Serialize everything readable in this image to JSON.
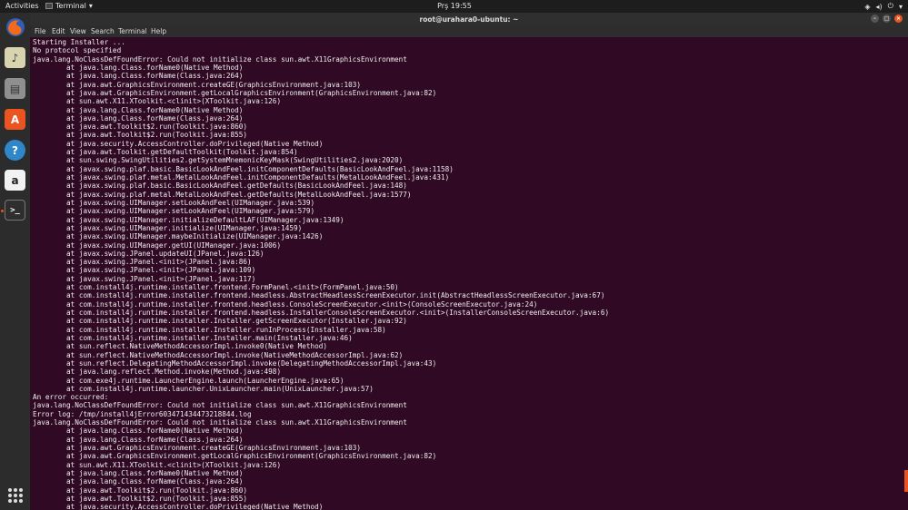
{
  "topbar": {
    "activities": "Activities",
    "app_name": "Terminal",
    "app_arrow": "▾",
    "clock": "Prş 19:55",
    "tray_icons": [
      "wifi-icon",
      "volume-icon",
      "power-icon"
    ],
    "tray_glyphs": [
      "◈",
      "◂)",
      "⏻"
    ],
    "tray_arrow": "▾"
  },
  "dock": {
    "items": [
      {
        "name": "firefox-icon",
        "glyph": "",
        "color": "#e66000"
      },
      {
        "name": "rhythmbox-icon",
        "glyph": "♪",
        "color": "#c9c06a"
      },
      {
        "name": "files-icon",
        "glyph": "▤",
        "color": "#9b9b9b"
      },
      {
        "name": "software-center-icon",
        "glyph": "A",
        "color": "#e95420"
      },
      {
        "name": "help-icon",
        "glyph": "?",
        "color": "#2f86c8"
      },
      {
        "name": "amazon-icon",
        "glyph": "a",
        "color": "#f2f2f2"
      },
      {
        "name": "terminal-icon",
        "glyph": ">_",
        "color": "#2e2e2e"
      }
    ],
    "accent": "#e95420"
  },
  "window": {
    "title": "root@urahara0-ubuntu: ~",
    "menu": [
      "File",
      "Edit",
      "View",
      "Search",
      "Terminal",
      "Help"
    ]
  },
  "terminal": {
    "lines": [
      "Starting Installer ...",
      "No protocol specified",
      "java.lang.NoClassDefFoundError: Could not initialize class sun.awt.X11GraphicsEnvironment",
      "        at java.lang.Class.forName0(Native Method)",
      "        at java.lang.Class.forName(Class.java:264)",
      "        at java.awt.GraphicsEnvironment.createGE(GraphicsEnvironment.java:103)",
      "        at java.awt.GraphicsEnvironment.getLocalGraphicsEnvironment(GraphicsEnvironment.java:82)",
      "        at sun.awt.X11.XToolkit.<clinit>(XToolkit.java:126)",
      "        at java.lang.Class.forName0(Native Method)",
      "        at java.lang.Class.forName(Class.java:264)",
      "        at java.awt.Toolkit$2.run(Toolkit.java:860)",
      "        at java.awt.Toolkit$2.run(Toolkit.java:855)",
      "        at java.security.AccessController.doPrivileged(Native Method)",
      "        at java.awt.Toolkit.getDefaultToolkit(Toolkit.java:854)",
      "        at sun.swing.SwingUtilities2.getSystemMnemonicKeyMask(SwingUtilities2.java:2020)",
      "        at javax.swing.plaf.basic.BasicLookAndFeel.initComponentDefaults(BasicLookAndFeel.java:1158)",
      "        at javax.swing.plaf.metal.MetalLookAndFeel.initComponentDefaults(MetalLookAndFeel.java:431)",
      "        at javax.swing.plaf.basic.BasicLookAndFeel.getDefaults(BasicLookAndFeel.java:148)",
      "        at javax.swing.plaf.metal.MetalLookAndFeel.getDefaults(MetalLookAndFeel.java:1577)",
      "        at javax.swing.UIManager.setLookAndFeel(UIManager.java:539)",
      "        at javax.swing.UIManager.setLookAndFeel(UIManager.java:579)",
      "        at javax.swing.UIManager.initializeDefaultLAF(UIManager.java:1349)",
      "        at javax.swing.UIManager.initialize(UIManager.java:1459)",
      "        at javax.swing.UIManager.maybeInitialize(UIManager.java:1426)",
      "        at javax.swing.UIManager.getUI(UIManager.java:1006)",
      "        at javax.swing.JPanel.updateUI(JPanel.java:126)",
      "        at javax.swing.JPanel.<init>(JPanel.java:86)",
      "        at javax.swing.JPanel.<init>(JPanel.java:109)",
      "        at javax.swing.JPanel.<init>(JPanel.java:117)",
      "        at com.install4j.runtime.installer.frontend.FormPanel.<init>(FormPanel.java:50)",
      "        at com.install4j.runtime.installer.frontend.headless.AbstractHeadlessScreenExecutor.init(AbstractHeadlessScreenExecutor.java:67)",
      "        at com.install4j.runtime.installer.frontend.headless.ConsoleScreenExecutor.<init>(ConsoleScreenExecutor.java:24)",
      "        at com.install4j.runtime.installer.frontend.headless.InstallerConsoleScreenExecutor.<init>(InstallerConsoleScreenExecutor.java:6)",
      "        at com.install4j.runtime.installer.Installer.getScreenExecutor(Installer.java:92)",
      "        at com.install4j.runtime.installer.Installer.runInProcess(Installer.java:58)",
      "        at com.install4j.runtime.installer.Installer.main(Installer.java:46)",
      "        at sun.reflect.NativeMethodAccessorImpl.invoke0(Native Method)",
      "        at sun.reflect.NativeMethodAccessorImpl.invoke(NativeMethodAccessorImpl.java:62)",
      "        at sun.reflect.DelegatingMethodAccessorImpl.invoke(DelegatingMethodAccessorImpl.java:43)",
      "        at java.lang.reflect.Method.invoke(Method.java:498)",
      "        at com.exe4j.runtime.LauncherEngine.launch(LauncherEngine.java:65)",
      "        at com.install4j.runtime.launcher.UnixLauncher.main(UnixLauncher.java:57)",
      "An error occurred:",
      "java.lang.NoClassDefFoundError: Could not initialize class sun.awt.X11GraphicsEnvironment",
      "Error log: /tmp/install4jError603471434473218844.log",
      "java.lang.NoClassDefFoundError: Could not initialize class sun.awt.X11GraphicsEnvironment",
      "        at java.lang.Class.forName0(Native Method)",
      "        at java.lang.Class.forName(Class.java:264)",
      "        at java.awt.GraphicsEnvironment.createGE(GraphicsEnvironment.java:103)",
      "        at java.awt.GraphicsEnvironment.getLocalGraphicsEnvironment(GraphicsEnvironment.java:82)",
      "        at sun.awt.X11.XToolkit.<clinit>(XToolkit.java:126)",
      "        at java.lang.Class.forName0(Native Method)",
      "        at java.lang.Class.forName(Class.java:264)",
      "        at java.awt.Toolkit$2.run(Toolkit.java:860)",
      "        at java.awt.Toolkit$2.run(Toolkit.java:855)",
      "        at java.security.AccessController.doPrivileged(Native Method)"
    ]
  }
}
